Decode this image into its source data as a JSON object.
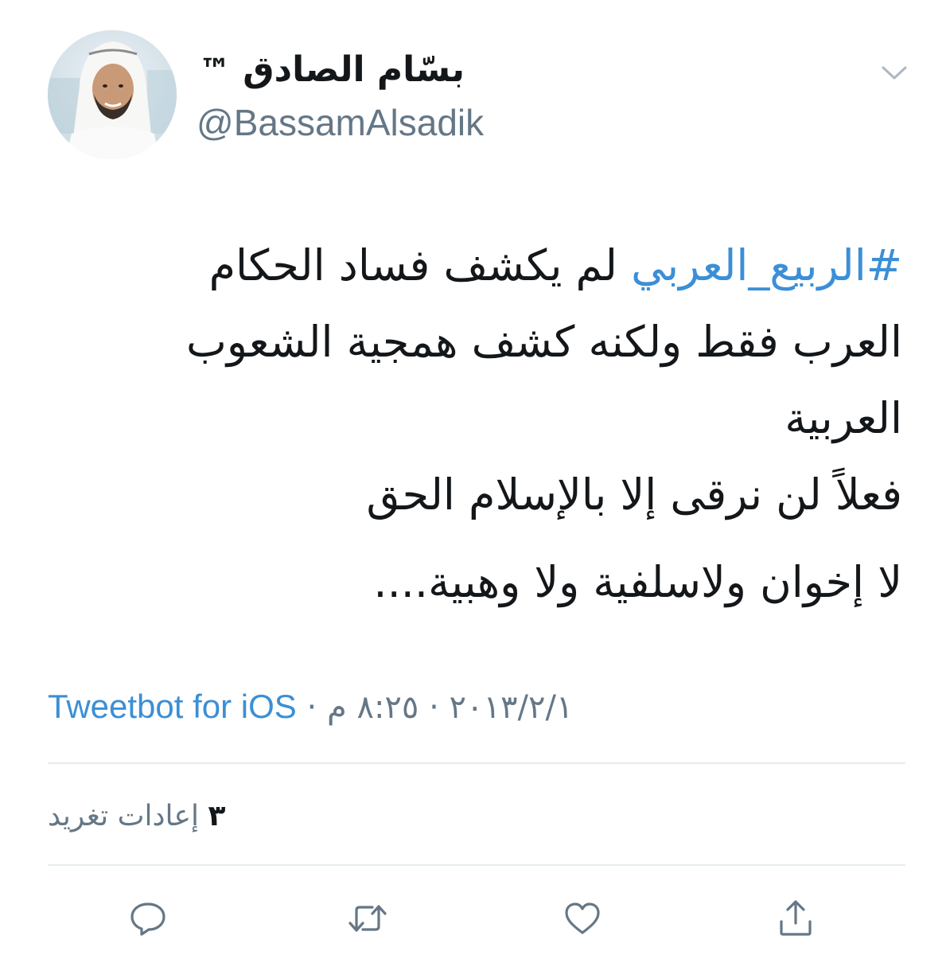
{
  "tweet": {
    "author": {
      "display_name": "بسّام الصادق",
      "trademark": "™",
      "handle": "@BassamAlsadik",
      "avatar_icon": "profile-photo"
    },
    "body": {
      "hashtag": "#الربيع_العربي",
      "line1_rest": " لم يكشف فساد الحكام",
      "line2": "العرب فقط ولكنه كشف همجية الشعوب",
      "line3": "العربية",
      "line4": "فعلاً لن نرقى إلا بالإسلام الحق",
      "line5": "لا إخوان ولاسلفية ولا وهبية...."
    },
    "meta": {
      "time": "٨:٢٥ م",
      "separator": " · ",
      "date": "٢٠١٣/٢/١",
      "source": "Tweetbot for iOS"
    },
    "stats": {
      "retweet_count": "٣",
      "retweet_label": "إعادات تغريد"
    },
    "actions": [
      "reply-icon",
      "retweet-icon",
      "like-icon",
      "share-icon"
    ],
    "colors": {
      "link": "#3b8fd6",
      "secondary_text": "#657786",
      "primary_text": "#14171a",
      "divider": "#e6ecf0"
    }
  }
}
